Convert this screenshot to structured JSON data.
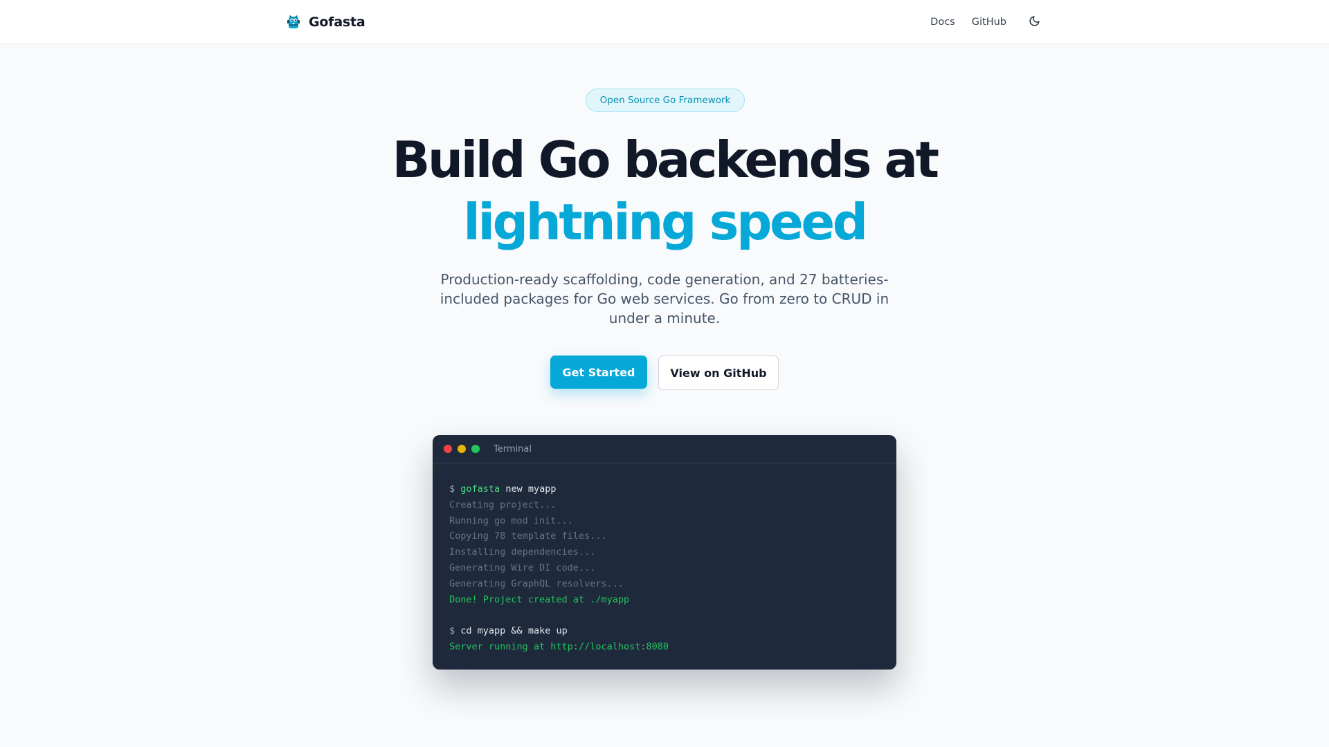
{
  "nav": {
    "brand": "Gofasta",
    "links": [
      "Docs",
      "GitHub"
    ],
    "theme_icon": "moon-icon"
  },
  "hero": {
    "badge": "Open Source Go Framework",
    "headline": "Build Go backends at",
    "headline_accent": "lightning speed",
    "subtitle": "Production-ready scaffolding, code generation, and 27 batteries-included packages for Go web services. Go from zero to CRUD in under a minute.",
    "primary_cta": "Get Started",
    "secondary_cta": "View on GitHub"
  },
  "terminal": {
    "title": "Terminal",
    "prompt": "$",
    "cmd1_tool": "gofasta",
    "cmd1_args": " new myapp",
    "output": [
      "Creating project...",
      "Running go mod init...",
      "Copying 78 template files...",
      "Installing dependencies...",
      "Generating Wire DI code...",
      "Generating GraphQL resolvers..."
    ],
    "done": "Done! Project created at ./myapp",
    "cmd2": "cd myapp && make up",
    "server": "Server running at http://localhost:8080"
  },
  "colors": {
    "accent": "#06a8d8",
    "success": "#22c55e",
    "terminal_bg": "#1e293b"
  }
}
